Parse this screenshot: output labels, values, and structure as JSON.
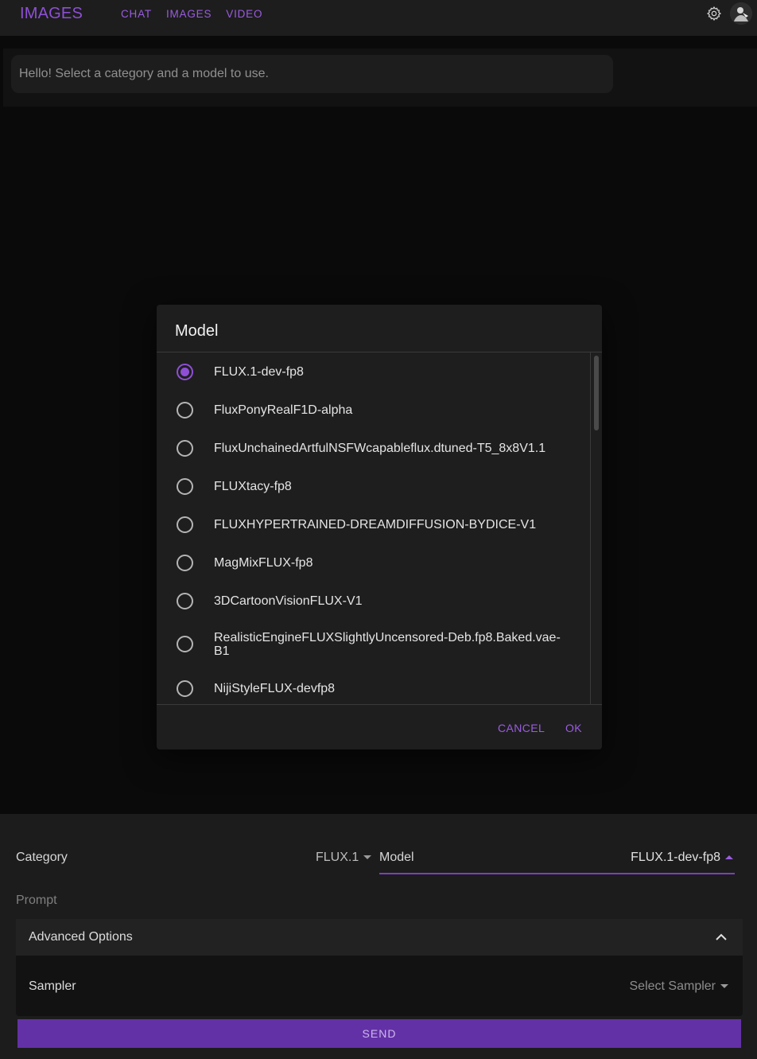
{
  "header": {
    "brand": "IMAGES",
    "nav": [
      "CHAT",
      "IMAGES",
      "VIDEO"
    ],
    "settings_icon": "gear-icon",
    "avatar_icon": "user-avatar"
  },
  "chat": {
    "message": "Hello! Select a category and a model to use."
  },
  "dialog": {
    "title": "Model",
    "selected_index": 0,
    "options": [
      "FLUX.1-dev-fp8",
      "FluxPonyRealF1D-alpha",
      "FluxUnchainedArtfulNSFWcapableflux.dtuned-T5_8x8V1.1",
      "FLUXtacy-fp8",
      "FLUXHYPERTRAINED-DREAMDIFFUSION-BYDICE-V1",
      "MagMixFLUX-fp8",
      "3DCartoonVisionFLUX-V1",
      "RealisticEngineFLUXSlightlyUncensored-Deb.fp8.Baked.vae-\nB1",
      "NijiStyleFLUX-devfp8"
    ],
    "cancel_label": "CANCEL",
    "ok_label": "OK"
  },
  "form": {
    "category_label": "Category",
    "category_value": "FLUX.1",
    "model_label": "Model",
    "model_value": "FLUX.1-dev-fp8",
    "prompt_label": "Prompt",
    "advanced_title": "Advanced Options",
    "sampler_label": "Sampler",
    "sampler_placeholder": "Select Sampler",
    "send_label": "SEND"
  },
  "colors": {
    "accent": "#8e4fd6",
    "send_button": "#6331a6",
    "background": "#101010"
  }
}
